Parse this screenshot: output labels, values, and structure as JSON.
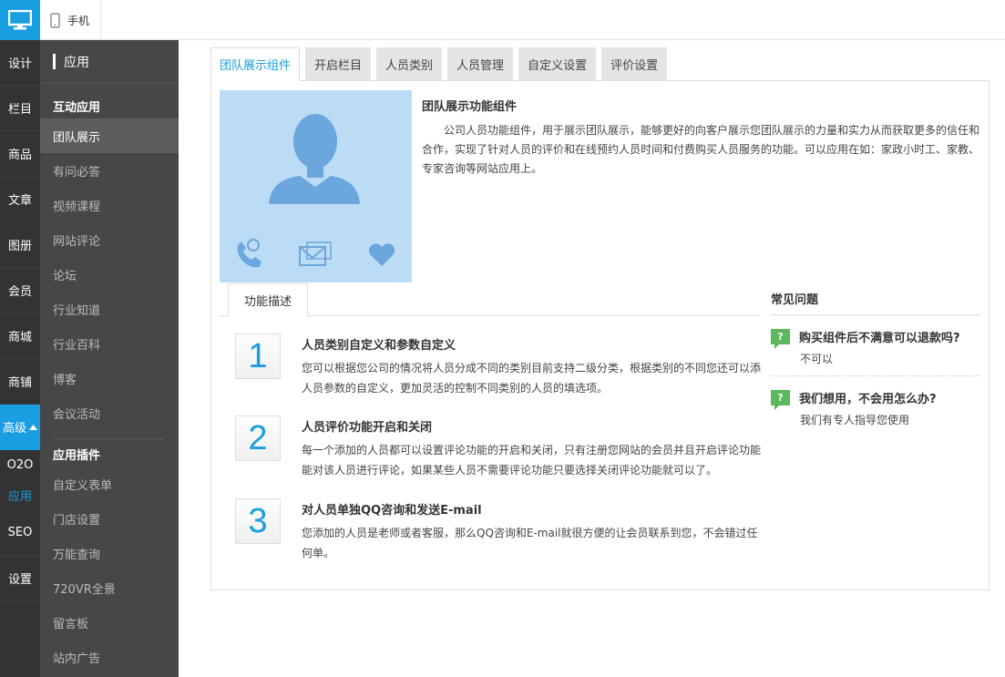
{
  "topbar": {
    "mobile_label": "手机"
  },
  "rail": {
    "items": [
      "设计",
      "栏目",
      "商品",
      "文章",
      "图册",
      "会员",
      "商城",
      "商铺"
    ],
    "active_label": "高级",
    "sub_items": [
      "O2O",
      "应用"
    ],
    "bottom_items": [
      "SEO",
      "设置"
    ]
  },
  "sidebar": {
    "header": "应用",
    "group1": "互动应用",
    "group1_items": [
      "团队展示",
      "有问必答",
      "视频课程",
      "网站评论",
      "论坛",
      "行业知道",
      "行业百科",
      "博客",
      "会议活动"
    ],
    "group2": "应用插件",
    "group2_items": [
      "自定义表单",
      "门店设置",
      "万能查询",
      "720VR全景",
      "留言板",
      "站内广告"
    ]
  },
  "tabs": [
    "团队展示组件",
    "开启栏目",
    "人员类别",
    "人员管理",
    "自定义设置",
    "评价设置"
  ],
  "intro": {
    "title": "团队展示功能组件",
    "text": "公司人员功能组件，用于展示团队展示，能够更好的向客户展示您团队展示的力量和实力从而获取更多的信任和合作，实现了针对人员的评价和在线预约人员时间和付费购买人员服务的功能。可以应用在如：家政小时工、家教、专家咨询等网站应用上。"
  },
  "sub_tab": "功能描述",
  "features": [
    {
      "num": "1",
      "title": "人员类别自定义和参数自定义",
      "desc": "您可以根据您公司的情况将人员分成不同的类别目前支持二级分类，根据类别的不同您还可以添人员参数的自定义，更加灵活的控制不同类别的人员的填选项。"
    },
    {
      "num": "2",
      "title": "人员评价功能开启和关闭",
      "desc": "每一个添加的人员都可以设置评论功能的开启和关闭，只有注册您网站的会员并且开启评论功能能对该人员进行评论，如果某些人员不需要评论功能只要选择关闭评论功能就可以了。"
    },
    {
      "num": "3",
      "title": "对人员单独QQ咨询和发送E-mail",
      "desc": "您添加的人员是老师或者客服，那么QQ咨询和E-mail就很方便的让会员联系到您，不会错过任何单。"
    }
  ],
  "faq": {
    "title": "常见问题",
    "items": [
      {
        "q": "购买组件后不满意可以退款吗?",
        "a": "不可以"
      },
      {
        "q": "我们想用，不会用怎么办?",
        "a": "我们有专人指导您使用"
      }
    ]
  },
  "colors": {
    "accent": "#1a9ee2",
    "rail_bg": "#333333",
    "sidebar_bg": "#474747",
    "preview_bg": "#bcdcf6",
    "faq_icon": "#5cb85c"
  }
}
